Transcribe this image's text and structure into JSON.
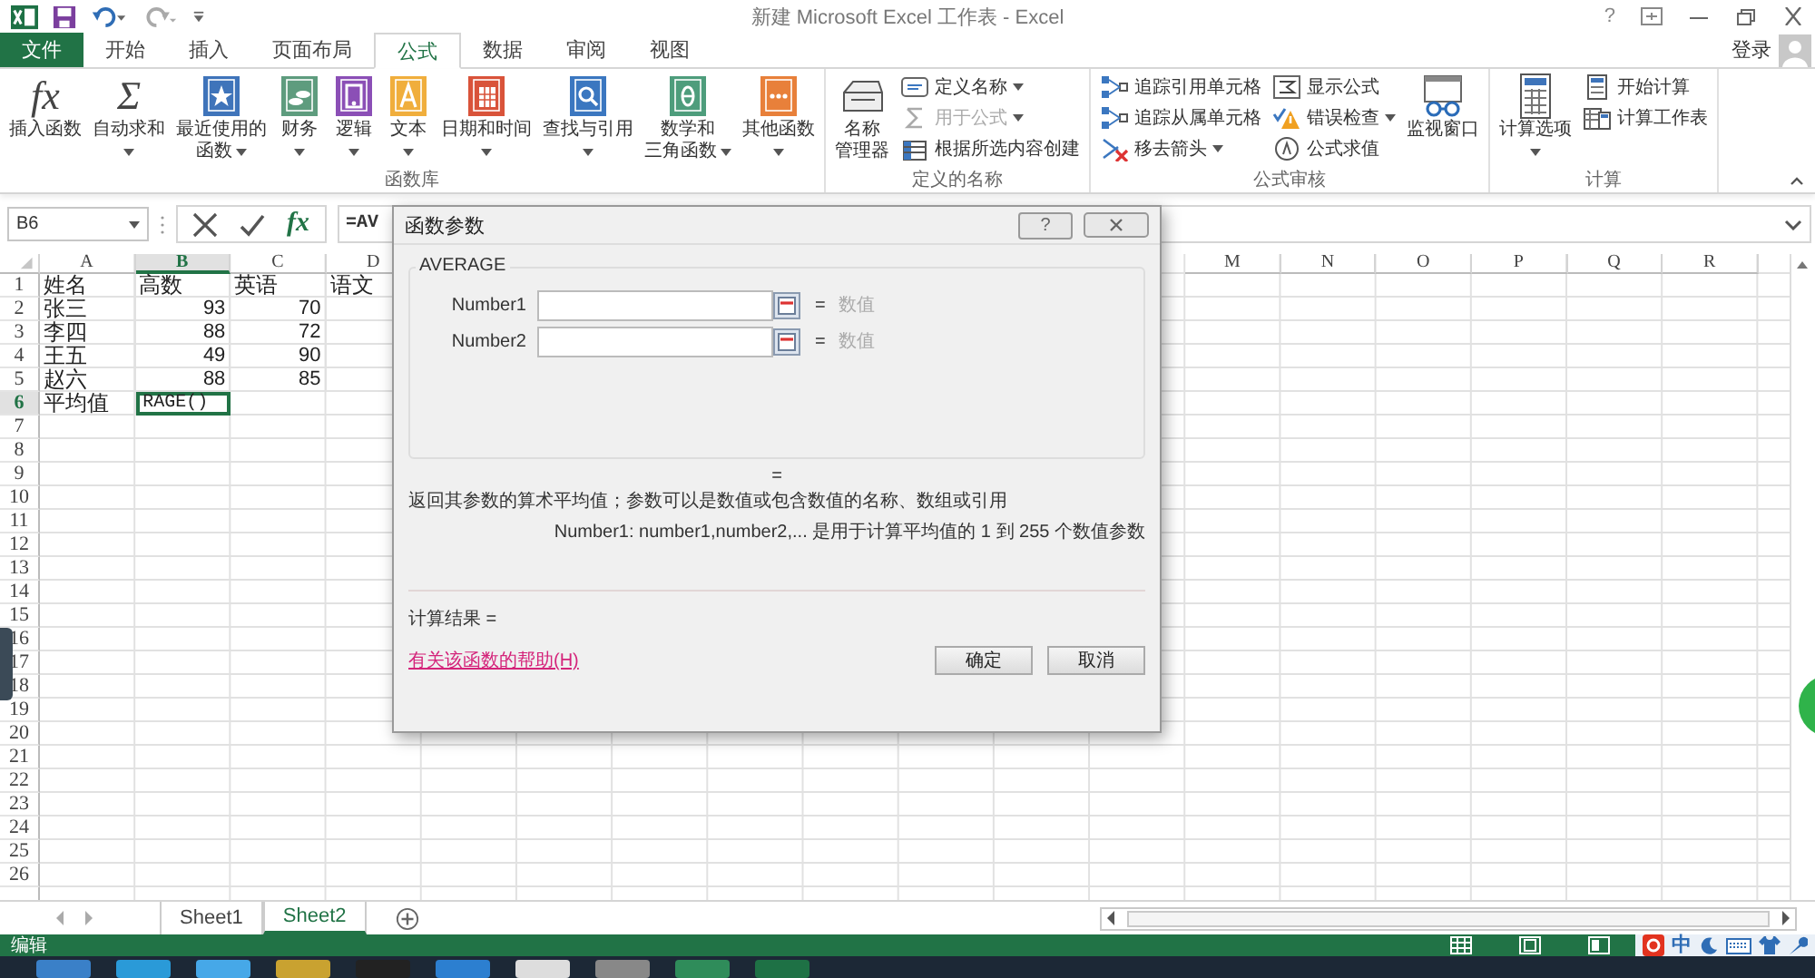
{
  "window": {
    "title": "新建 Microsoft Excel 工作表 - Excel",
    "help": "?"
  },
  "tabs": [
    {
      "label": "文件",
      "kind": "file",
      "selected": false
    },
    {
      "label": "开始",
      "kind": "tab",
      "selected": false
    },
    {
      "label": "插入",
      "kind": "tab",
      "selected": false
    },
    {
      "label": "页面布局",
      "kind": "tab",
      "selected": false
    },
    {
      "label": "公式",
      "kind": "tab",
      "selected": true
    },
    {
      "label": "数据",
      "kind": "tab",
      "selected": false
    },
    {
      "label": "审阅",
      "kind": "tab",
      "selected": false
    },
    {
      "label": "视图",
      "kind": "tab",
      "selected": false
    }
  ],
  "account": {
    "label": "登录"
  },
  "ribbon": {
    "groups": [
      {
        "label": "函数库",
        "items": [
          {
            "kind": "large",
            "lines": [
              "插入函数"
            ],
            "glyph": "fx",
            "dropdown": false
          },
          {
            "kind": "large",
            "lines": [
              "自动求和"
            ],
            "glyph": "Σ",
            "dropdown": true
          },
          {
            "kind": "large",
            "lines": [
              "最近使用的",
              "函数"
            ],
            "dropdown": true
          },
          {
            "kind": "large",
            "lines": [
              "财务"
            ],
            "dropdown": true
          },
          {
            "kind": "large",
            "lines": [
              "逻辑"
            ],
            "dropdown": true
          },
          {
            "kind": "large",
            "lines": [
              "文本"
            ],
            "dropdown": true
          },
          {
            "kind": "large",
            "lines": [
              "日期和时间"
            ],
            "dropdown": true
          },
          {
            "kind": "large",
            "lines": [
              "查找与引用"
            ],
            "dropdown": true
          },
          {
            "kind": "large",
            "lines": [
              "数学和",
              "三角函数"
            ],
            "dropdown": true
          },
          {
            "kind": "large",
            "lines": [
              "其他函数"
            ],
            "dropdown": true
          }
        ]
      },
      {
        "label": "定义的名称",
        "items": [
          {
            "kind": "large",
            "lines": [
              "名称",
              "管理器"
            ],
            "dropdown": false
          },
          {
            "kind": "stack",
            "items": [
              {
                "label": "定义名称",
                "dropdown": true,
                "disabled": false
              },
              {
                "label": "用于公式",
                "dropdown": true,
                "disabled": true
              },
              {
                "label": "根据所选内容创建",
                "dropdown": false,
                "disabled": false
              }
            ]
          }
        ]
      },
      {
        "label": "公式审核",
        "items": [
          {
            "kind": "stack",
            "items": [
              {
                "label": "追踪引用单元格",
                "dropdown": false,
                "disabled": false
              },
              {
                "label": "追踪从属单元格",
                "dropdown": false,
                "disabled": false
              },
              {
                "label": "移去箭头",
                "dropdown": true,
                "disabled": false
              }
            ]
          },
          {
            "kind": "stack",
            "items": [
              {
                "label": "显示公式",
                "dropdown": false,
                "disabled": false
              },
              {
                "label": "错误检查",
                "dropdown": true,
                "disabled": false
              },
              {
                "label": "公式求值",
                "dropdown": false,
                "disabled": false
              }
            ]
          },
          {
            "kind": "large",
            "lines": [
              "监视窗口"
            ],
            "dropdown": false
          }
        ]
      },
      {
        "label": "计算",
        "items": [
          {
            "kind": "large",
            "lines": [
              "计算选项"
            ],
            "dropdown": true
          },
          {
            "kind": "stack",
            "items": [
              {
                "label": "开始计算",
                "dropdown": false,
                "disabled": false
              },
              {
                "label": "计算工作表",
                "dropdown": false,
                "disabled": false
              }
            ]
          }
        ]
      }
    ]
  },
  "formula_bar": {
    "name_box": "B6",
    "fx": "fx",
    "formula": "=AV"
  },
  "sheet": {
    "columns": [
      {
        "label": "A",
        "selected": false
      },
      {
        "label": "B",
        "selected": true
      },
      {
        "label": "C",
        "selected": false
      },
      {
        "label": "D",
        "selected": false
      },
      {
        "label": "M",
        "selected": false
      },
      {
        "label": "N",
        "selected": false
      },
      {
        "label": "O",
        "selected": false
      },
      {
        "label": "P",
        "selected": false
      },
      {
        "label": "Q",
        "selected": false
      },
      {
        "label": "R",
        "selected": false
      }
    ],
    "rows": [
      {
        "label": "1",
        "selected": false,
        "cells": [
          {
            "text": "姓名",
            "kind": "text",
            "selected": false
          },
          {
            "text": "高数",
            "kind": "text",
            "selected": false
          },
          {
            "text": "英语",
            "kind": "text",
            "selected": false
          },
          {
            "text": "语文",
            "kind": "text",
            "selected": false
          }
        ]
      },
      {
        "label": "2",
        "selected": false,
        "cells": [
          {
            "text": "张三",
            "kind": "text",
            "selected": false
          },
          {
            "text": "93",
            "kind": "number",
            "selected": false
          },
          {
            "text": "70",
            "kind": "number",
            "selected": false
          }
        ]
      },
      {
        "label": "3",
        "selected": false,
        "cells": [
          {
            "text": "李四",
            "kind": "text",
            "selected": false
          },
          {
            "text": "88",
            "kind": "number",
            "selected": false
          },
          {
            "text": "72",
            "kind": "number",
            "selected": false
          }
        ]
      },
      {
        "label": "4",
        "selected": false,
        "cells": [
          {
            "text": "王五",
            "kind": "text",
            "selected": false
          },
          {
            "text": "49",
            "kind": "number",
            "selected": false
          },
          {
            "text": "90",
            "kind": "number",
            "selected": false
          }
        ]
      },
      {
        "label": "5",
        "selected": false,
        "cells": [
          {
            "text": "赵六",
            "kind": "text",
            "selected": false
          },
          {
            "text": "88",
            "kind": "number",
            "selected": false
          },
          {
            "text": "85",
            "kind": "number",
            "selected": false
          }
        ]
      },
      {
        "label": "6",
        "selected": true,
        "cells": [
          {
            "text": "平均值",
            "kind": "text",
            "selected": false
          },
          {
            "text": "RAGE()",
            "kind": "text",
            "selected": true
          }
        ]
      },
      {
        "label": "7",
        "selected": false
      },
      {
        "label": "8",
        "selected": false
      },
      {
        "label": "9",
        "selected": false
      },
      {
        "label": "10",
        "selected": false
      },
      {
        "label": "11",
        "selected": false
      },
      {
        "label": "12",
        "selected": false
      },
      {
        "label": "13",
        "selected": false
      },
      {
        "label": "14",
        "selected": false
      },
      {
        "label": "15",
        "selected": false
      },
      {
        "label": "16",
        "selected": false
      },
      {
        "label": "17",
        "selected": false
      },
      {
        "label": "18",
        "selected": false
      },
      {
        "label": "19",
        "selected": false
      },
      {
        "label": "20",
        "selected": false
      },
      {
        "label": "21",
        "selected": false
      },
      {
        "label": "22",
        "selected": false
      },
      {
        "label": "23",
        "selected": false
      },
      {
        "label": "24",
        "selected": false
      },
      {
        "label": "25",
        "selected": false
      },
      {
        "label": "26",
        "selected": false
      }
    ]
  },
  "sheet_tabs": [
    {
      "label": "Sheet1",
      "selected": false
    },
    {
      "label": "Sheet2",
      "selected": true
    }
  ],
  "status_bar": {
    "mode": "编辑",
    "ime": "中"
  },
  "dialog": {
    "title": "函数参数",
    "help": "?",
    "function": "AVERAGE",
    "args": [
      {
        "label": "Number1",
        "equals": "=",
        "hint": "数值"
      },
      {
        "label": "Number2",
        "equals": "=",
        "hint": "数值"
      }
    ],
    "result_preview": "=",
    "description": "返回其参数的算术平均值；参数可以是数值或包含数值的名称、数组或引用",
    "arg_help": "Number1:  number1,number2,... 是用于计算平均值的 1 到 255 个数值参数",
    "result_label": "计算结果 =",
    "help_link": "有关该函数的帮助(H)",
    "buttons": [
      "确定",
      "取消"
    ]
  }
}
